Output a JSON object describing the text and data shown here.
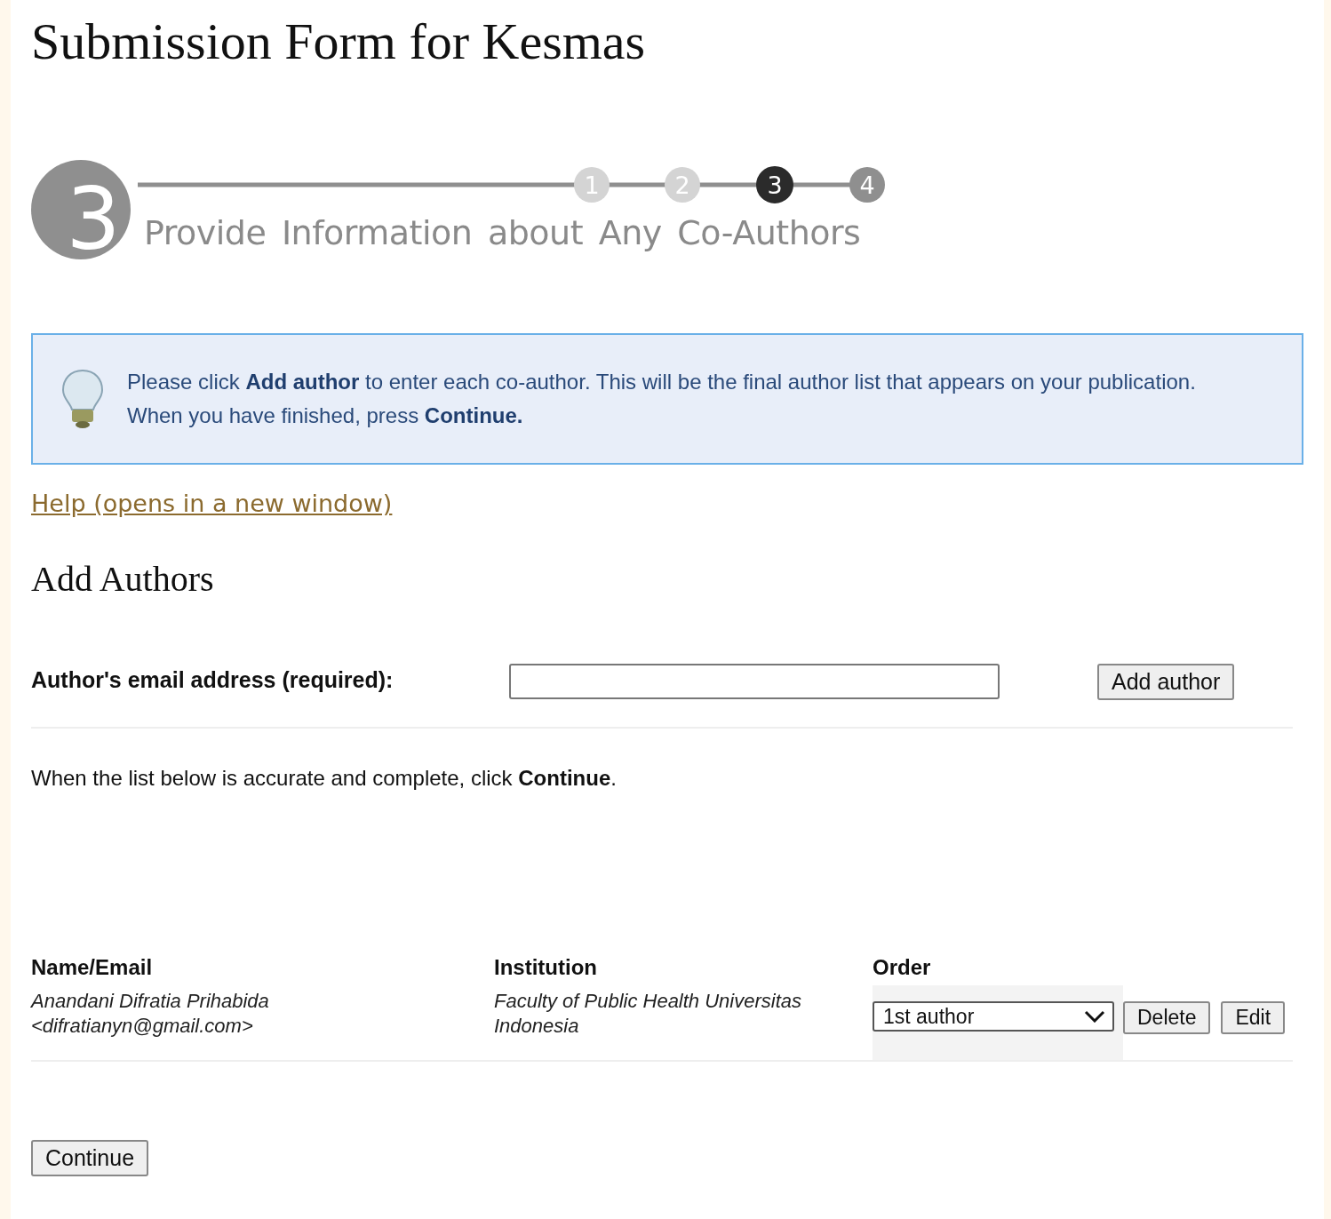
{
  "page_title": "Submission Form for Kesmas",
  "progress": {
    "big_number": "3",
    "title": "Provide Information about Any Co-Authors",
    "steps": [
      {
        "label": "1",
        "completed": true,
        "selected": false
      },
      {
        "label": "2",
        "completed": true,
        "selected": false
      },
      {
        "label": "3",
        "completed": false,
        "selected": true
      },
      {
        "label": "4",
        "completed": false,
        "selected": false
      }
    ]
  },
  "info": {
    "lines": [
      "Please click **Add author** to enter each co-author. This will be the final author list that appears on your publication.",
      "When you have finished, press **Continue.**"
    ]
  },
  "help_link": "Help (opens in a new window)",
  "section_title": "Add Authors",
  "email_field": {
    "label": "Author's email address (required):"
  },
  "add_button": "Add author",
  "instruction": "When the list below is accurate and complete, click **Continue**.",
  "table": {
    "columns": [
      "Name/Email",
      "Institution",
      "Order"
    ],
    "rows": [
      {
        "name": "Anandani Difratia Prihabida",
        "email": "<difratianyn@gmail.com>",
        "institution": "Faculty of Public Health Universitas Indonesia",
        "order": "1st author",
        "actions": [
          "Delete",
          "Edit"
        ]
      }
    ]
  },
  "continue_button": "Continue"
}
